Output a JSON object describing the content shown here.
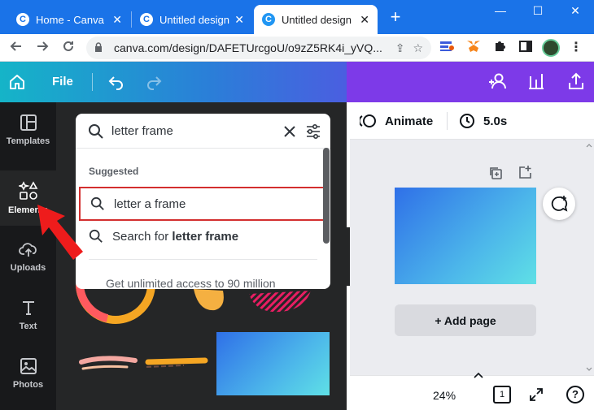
{
  "browser": {
    "tabs": [
      {
        "title": "Home - Canva",
        "favicon": "C"
      },
      {
        "title": "Untitled design -",
        "favicon": "C"
      },
      {
        "title": "Untitled design -",
        "favicon": "C"
      }
    ],
    "new_tab": "+",
    "window_controls": {
      "minimize": "—",
      "restore": "☐",
      "close": "✕"
    },
    "url": "canva.com/design/DAFETUrcgoU/o9zZ5RK4i_yVQ...",
    "colors": {
      "tabbar": "#1a73e8"
    }
  },
  "canva_header": {
    "file_label": "File"
  },
  "rail": {
    "items": [
      {
        "label": "Templates",
        "icon": "templates-icon"
      },
      {
        "label": "Elements",
        "icon": "elements-icon"
      },
      {
        "label": "Uploads",
        "icon": "uploads-icon"
      },
      {
        "label": "Text",
        "icon": "text-icon"
      },
      {
        "label": "Photos",
        "icon": "photos-icon"
      }
    ],
    "active": "Elements"
  },
  "search": {
    "query": "letter frame",
    "suggested_heading": "Suggested",
    "suggestion": "letter a frame",
    "search_for_prefix": "Search for ",
    "search_for_term": "letter frame",
    "promo": "Get unlimited access to 90 million"
  },
  "editor": {
    "animate_label": "Animate",
    "duration": "5.0s",
    "add_page": "+ Add page",
    "zoom": "24%",
    "page_number": "1",
    "help": "?"
  }
}
